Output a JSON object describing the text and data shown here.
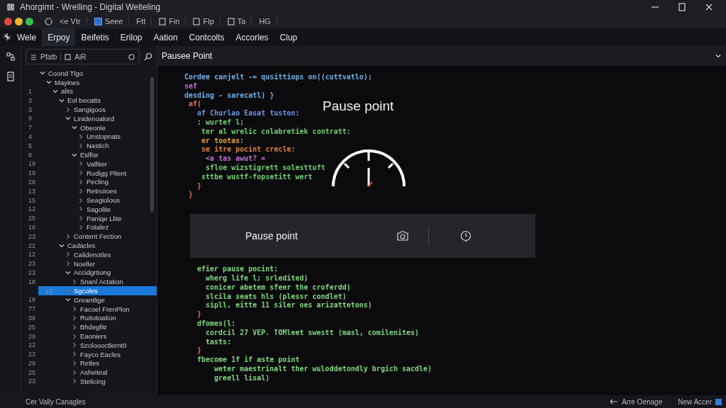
{
  "window": {
    "title": "Ahorgimt - Wrelling - Digital Welteling"
  },
  "toolbar": [
    {
      "label": "<e Vtr",
      "kind": "text"
    },
    {
      "label": "Seee",
      "kind": "blue"
    },
    {
      "label": "Ftt",
      "kind": "text"
    },
    {
      "label": "Fin",
      "kind": "doc"
    },
    {
      "label": "Flp",
      "kind": "doc"
    },
    {
      "label": "Ta",
      "kind": "doc"
    },
    {
      "label": "HG",
      "kind": "text"
    }
  ],
  "menu": [
    {
      "label": "Wele",
      "selected": false
    },
    {
      "label": "Erpoy",
      "selected": true
    },
    {
      "label": "Beifetis",
      "selected": false
    },
    {
      "label": "Erilop",
      "selected": false
    },
    {
      "label": "Aation",
      "selected": false
    },
    {
      "label": "Contcolts",
      "selected": false
    },
    {
      "label": "Accorles",
      "selected": false
    },
    {
      "label": "Clup",
      "selected": false
    }
  ],
  "search": {
    "scope": "Pfatb",
    "value": "AiR"
  },
  "tree": [
    {
      "label": "Coond Tlgo",
      "selected": false,
      "expanded": true,
      "children": [
        {
          "label": "Mayines",
          "selected": false,
          "expanded": true,
          "children": [
            {
              "num": "1",
              "label": "alits",
              "selected": false,
              "expanded": true,
              "children": [
                {
                  "num": "3",
                  "label": "Eol becatts",
                  "selected": false,
                  "expanded": true,
                  "children": [
                    {
                      "num": "3",
                      "label": "Sangigoos",
                      "selected": false
                    },
                    {
                      "num": "9",
                      "label": "Linidenoalord",
                      "selected": false,
                      "expanded": true,
                      "children": [
                        {
                          "num": "7",
                          "label": "Obeonle",
                          "selected": false,
                          "expanded": true,
                          "children": [
                            {
                              "num": "4",
                              "label": "Unstopnats",
                              "selected": false
                            },
                            {
                              "num": "5",
                              "label": "Nastich",
                              "selected": false
                            }
                          ]
                        },
                        {
                          "num": "8",
                          "label": "Eslfisr",
                          "selected": false,
                          "expanded": true,
                          "children": [
                            {
                              "num": "19",
                              "label": "Valfiter",
                              "selected": false
                            },
                            {
                              "num": "19",
                              "label": "Rodigg Plient",
                              "selected": false
                            },
                            {
                              "num": "28",
                              "label": "Pecling",
                              "selected": false
                            },
                            {
                              "num": "13",
                              "label": "Retnoioes",
                              "selected": false
                            },
                            {
                              "num": "15",
                              "label": "Seagiolous",
                              "selected": false
                            },
                            {
                              "num": "12",
                              "label": "Sagolite",
                              "selected": false
                            },
                            {
                              "num": "25",
                              "label": "Paniqe Llite",
                              "selected": false
                            },
                            {
                              "num": "18",
                              "label": "Fotalez",
                              "selected": false
                            }
                          ]
                        }
                      ]
                    },
                    {
                      "num": "23",
                      "label": "Content Fection",
                      "selected": false
                    }
                  ]
                },
                {
                  "num": "22",
                  "label": "Cadacles",
                  "selected": false,
                  "expanded": true,
                  "children": [
                    {
                      "num": "12",
                      "label": "Calidenotles",
                      "selected": false
                    },
                    {
                      "num": "23",
                      "label": "Noeller",
                      "selected": false
                    },
                    {
                      "num": "23",
                      "label": "Accidgrtiong",
                      "selected": false,
                      "expanded": true,
                      "children": [
                        {
                          "num": "18",
                          "label": "Snanl Actation",
                          "selected": false
                        }
                      ]
                    },
                    {
                      "num": "13",
                      "label": "Sgcoles",
                      "selected": true
                    },
                    {
                      "num": "18",
                      "label": "Greantlige",
                      "selected": false,
                      "expanded": true,
                      "children": [
                        {
                          "num": "77",
                          "label": "Facoel FrenPlon",
                          "selected": false
                        },
                        {
                          "num": "39",
                          "label": "Ruitotoation",
                          "selected": false
                        },
                        {
                          "num": "25",
                          "label": "Bhdegfitr",
                          "selected": false
                        },
                        {
                          "num": "29",
                          "label": "Eaoniers",
                          "selected": false
                        },
                        {
                          "num": "22",
                          "label": "Szoloooctlernt0",
                          "selected": false
                        },
                        {
                          "num": "23",
                          "label": "Fayco Eacles",
                          "selected": false
                        },
                        {
                          "num": "29",
                          "label": "Retles",
                          "selected": false
                        },
                        {
                          "num": "25",
                          "label": "Ashviteal",
                          "selected": false
                        },
                        {
                          "num": "23",
                          "label": "Stelicing",
                          "selected": false
                        }
                      ]
                    }
                  ]
                }
              ]
            }
          ]
        }
      ]
    }
  ],
  "editor": {
    "tab": "Pausee Point",
    "code_top": [
      {
        "text": "Cordee canjelt -= qusittiops on((cuttvatlo);",
        "color": "#6fb0e8"
      },
      {
        "text": "sef",
        "color": "#c070d0"
      },
      {
        "text": "desding - sarecatl) }",
        "color": "#6fb0e8"
      },
      {
        "text": " af(",
        "color": "#e07050"
      },
      {
        "text": "   af Churlao Easat tuston:",
        "color": "#7090e0"
      },
      {
        "text": "   : wurtef l;",
        "color": "#6fcf6f"
      },
      {
        "text": "    ter al wrelic colabretiek contratt:",
        "color": "#6fcf6f"
      },
      {
        "text": "    er tootas:",
        "color": "#e0a040"
      },
      {
        "text": "    se itre pocint crecle:",
        "color": "#e08040"
      },
      {
        "text": "     <a tas awut? =",
        "color": "#c070d0"
      },
      {
        "text": "     sfloe wizstigrett solesttuft",
        "color": "#6fcf6f"
      },
      {
        "text": "    sttbe wustf-fopsetitt wert",
        "color": "#6fcf6f"
      },
      {
        "text": "   }",
        "color": "#e07050"
      },
      {
        "text": " }",
        "color": "#e07050"
      }
    ],
    "overlay_title": "Pause point",
    "panel": {
      "label": "Pause point"
    },
    "code_bottom": [
      {
        "text": "efier pause pocint:",
        "color": "#7fd67f"
      },
      {
        "text": "  wherg life l; srledited)",
        "color": "#7fd67f"
      },
      {
        "text": "  conicer abetem sfeer the croferdd)",
        "color": "#7fd67f"
      },
      {
        "text": "  slcila seats hls (plessr condlet)",
        "color": "#7fd67f"
      },
      {
        "text": "  sipll, eitte 11 siler oes arizattetons)",
        "color": "#7fd67f"
      },
      {
        "text": "}",
        "color": "#e07050"
      },
      {
        "text": "dfomes(l:",
        "color": "#7fd67f"
      },
      {
        "text": "  cordcil 27 VEP. TOMleet swestt (masl, comilenites)",
        "color": "#7fd67f"
      },
      {
        "text": "  tasts:",
        "color": "#7fd67f"
      },
      {
        "text": "}",
        "color": "#e07050"
      },
      {
        "text": "fbecome 1f if aste point",
        "color": "#7fd67f"
      },
      {
        "text": "    weter maestrinalt ther wuloddetondly brgich sacdle)",
        "color": "#7fd67f"
      },
      {
        "text": "    greell lisal)",
        "color": "#7fd67f"
      }
    ]
  },
  "status_bar": {
    "left": "Cer Vally Canagles",
    "items": [
      {
        "label": "Arre Oenage",
        "kind": "arrow"
      },
      {
        "label": "New Accer",
        "kind": "square"
      }
    ]
  }
}
